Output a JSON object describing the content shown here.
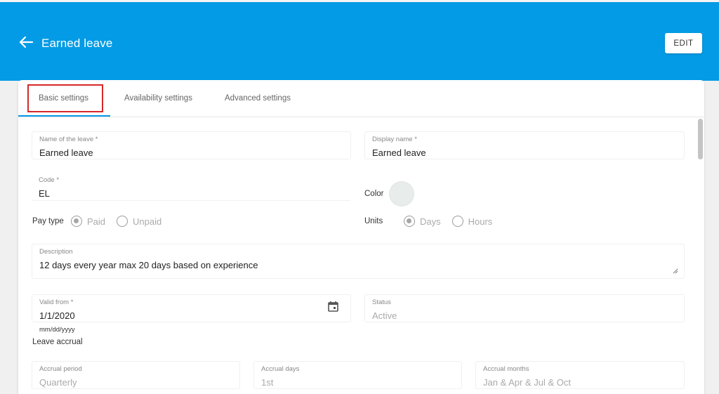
{
  "header": {
    "title": "Earned leave",
    "edit_label": "EDIT"
  },
  "tabs": [
    {
      "label": "Basic settings",
      "active": true
    },
    {
      "label": "Availability settings",
      "active": false
    },
    {
      "label": "Advanced settings",
      "active": false
    }
  ],
  "form": {
    "name": {
      "label": "Name of the leave *",
      "value": "Earned leave"
    },
    "display_name": {
      "label": "Display name *",
      "value": "Earned leave"
    },
    "code": {
      "label": "Code *",
      "value": "EL"
    },
    "color": {
      "label": "Color",
      "value": "#e8ecea"
    },
    "pay_type": {
      "label": "Pay type",
      "options": [
        "Paid",
        "Unpaid"
      ],
      "selected": "Paid"
    },
    "units": {
      "label": "Units",
      "options": [
        "Days",
        "Hours"
      ],
      "selected": "Days"
    },
    "description": {
      "label": "Description",
      "value": "12 days every year max 20 days based on experience"
    },
    "valid_from": {
      "label": "Valid from *",
      "value": "1/1/2020",
      "format_hint": "mm/dd/yyyy"
    },
    "status": {
      "label": "Status",
      "value": "Active"
    },
    "leave_accrual": {
      "label": "Leave accrual"
    },
    "accrual_period": {
      "label": "Accrual period",
      "value": "Quarterly"
    },
    "accrual_days": {
      "label": "Accrual days",
      "value": "1st"
    },
    "accrual_months": {
      "label": "Accrual months",
      "value": "Jan & Apr & Jul & Oct"
    }
  },
  "colors": {
    "header_bg": "#039be5",
    "highlight": "#d62828"
  },
  "icons": {
    "back": "arrow-left-icon",
    "calendar": "calendar-icon"
  }
}
